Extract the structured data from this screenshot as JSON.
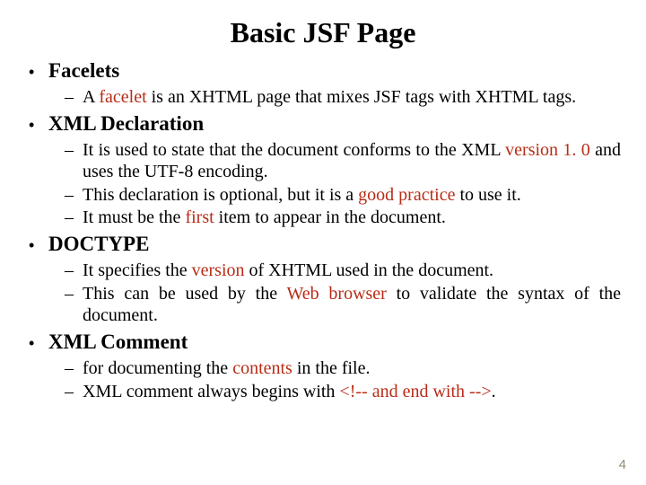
{
  "title": "Basic JSF Page",
  "sections": [
    {
      "heading": "Facelets",
      "items": [
        {
          "pre": "A ",
          "hl": "facelet",
          "post": " is an XHTML page that mixes JSF tags with XHTML tags."
        }
      ]
    },
    {
      "heading": "XML Declaration",
      "items": [
        {
          "pre": "It is used to state that the document conforms to the XML ",
          "hl": "version 1. 0",
          "post": " and uses the UTF-8 encoding."
        },
        {
          "pre": "This declaration is optional, but it is a ",
          "hl": "good practice",
          "post": " to use it."
        },
        {
          "pre": "It must be the ",
          "hl": "first",
          "post": " item to appear in the document."
        }
      ]
    },
    {
      "heading": "DOCTYPE",
      "items": [
        {
          "pre": "It specifies the ",
          "hl": "version",
          "post": " of XHTML used in the document."
        },
        {
          "pre": "This can be used by the ",
          "hl": "Web browser",
          "post": " to validate the syntax of the document."
        }
      ]
    },
    {
      "heading": "XML Comment",
      "items": [
        {
          "pre": "for documenting the ",
          "hl": "contents",
          "post": " in the file."
        },
        {
          "pre": "XML comment always begins with ",
          "hl": "<!-- and end with -->",
          "post": "."
        }
      ]
    }
  ],
  "pageNumber": "4"
}
